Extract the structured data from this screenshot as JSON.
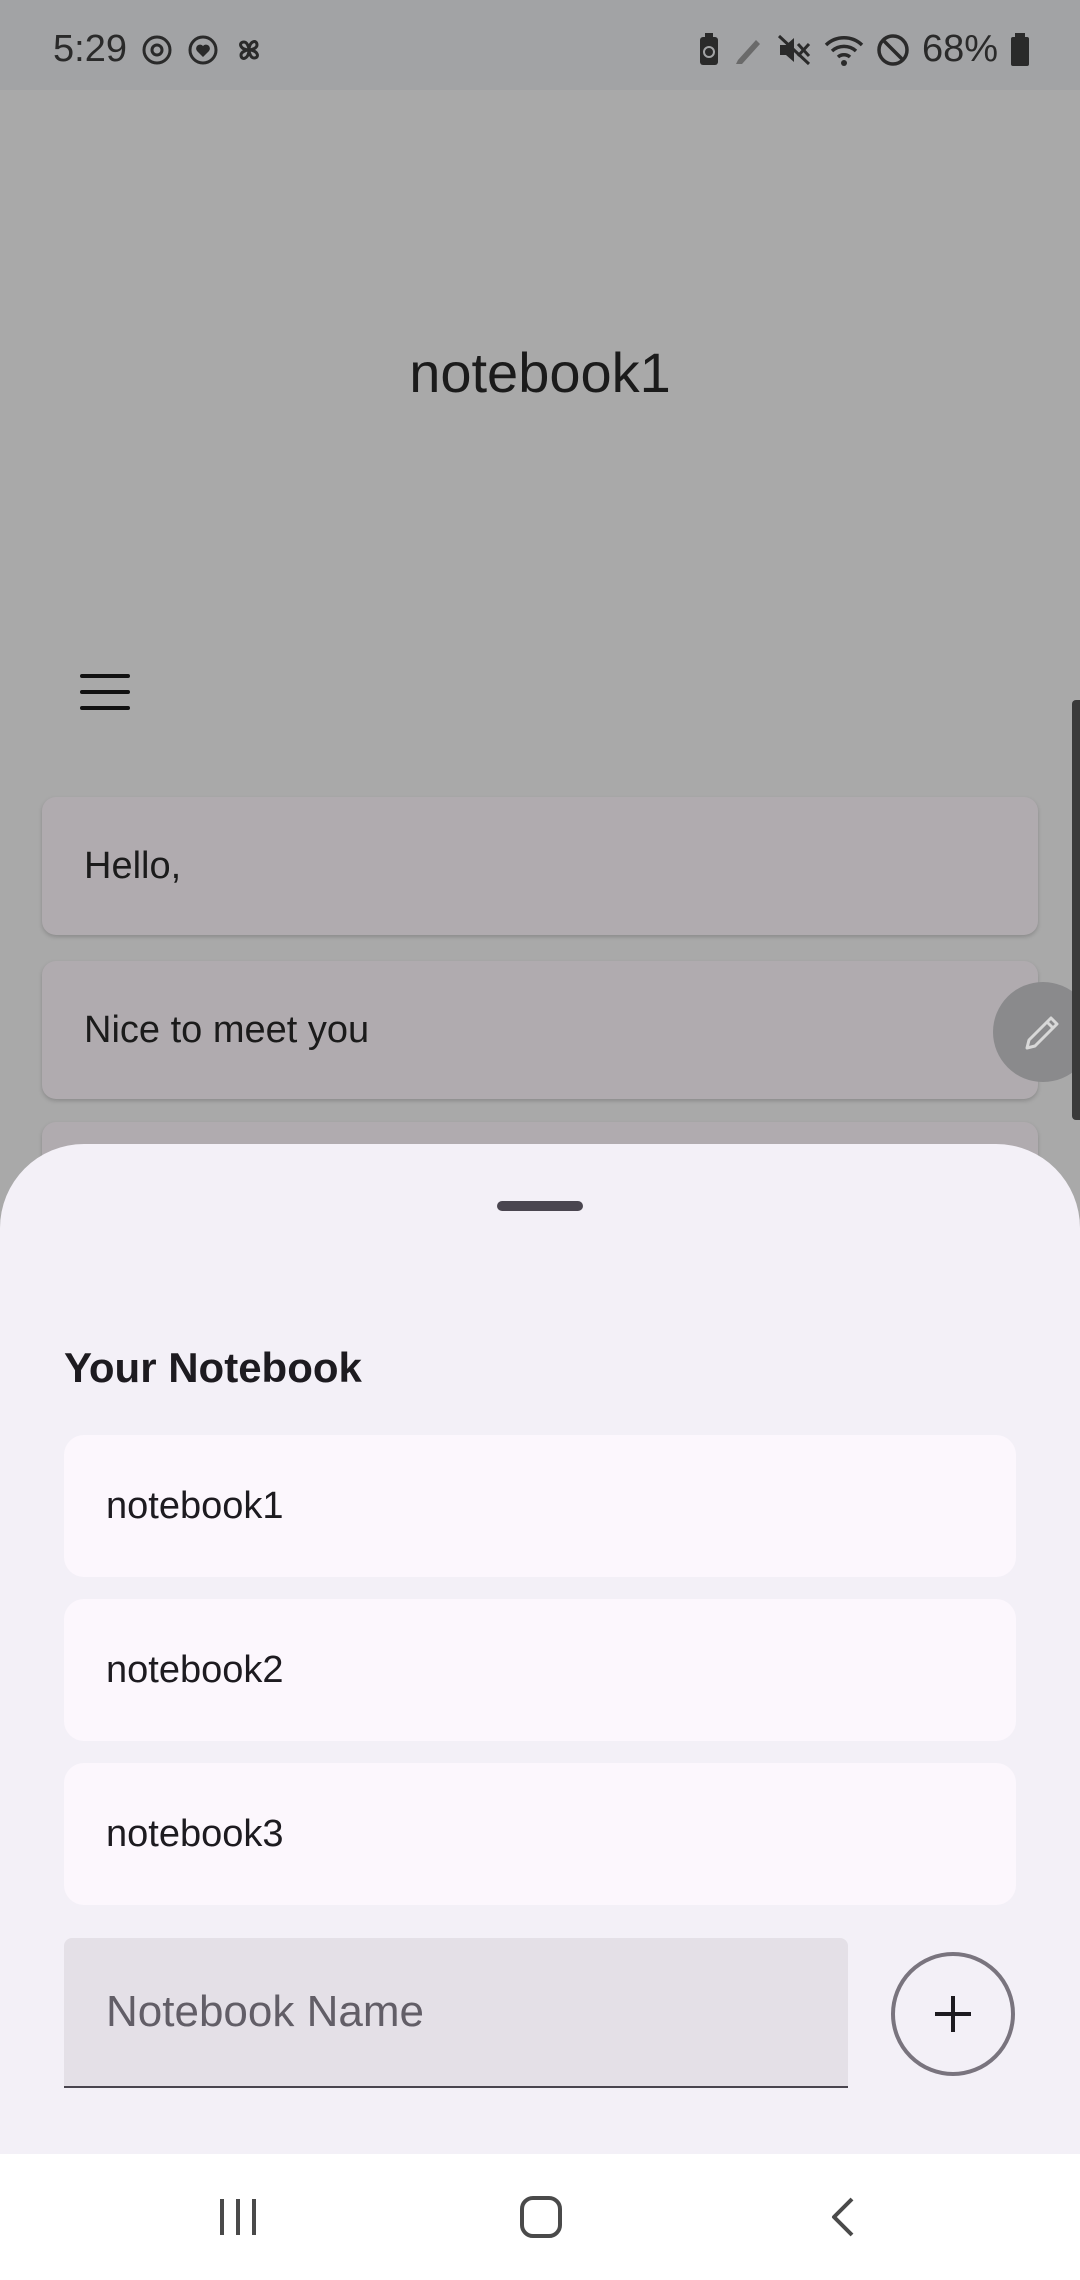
{
  "status_bar": {
    "time": "5:29",
    "left_icons": [
      "vpn-icon",
      "heart-icon",
      "pinwheel-icon"
    ],
    "right_icons": [
      "battery-saver-icon",
      "pen-icon",
      "mute-icon",
      "wifi-icon",
      "do-not-disturb-icon",
      "battery-icon"
    ],
    "battery_percent": "68%"
  },
  "app": {
    "title": "notebook1",
    "menu_icon": "menu-icon",
    "notes": [
      {
        "text": "Hello,"
      },
      {
        "text": "Nice to meet you"
      }
    ],
    "edit_icon": "pencil-icon"
  },
  "sheet": {
    "title": "Your Notebook",
    "notebooks": [
      {
        "name": "notebook1"
      },
      {
        "name": "notebook2"
      },
      {
        "name": "notebook3"
      }
    ],
    "input": {
      "placeholder": "Notebook Name",
      "value": ""
    },
    "add_icon": "plus-icon"
  },
  "nav_bar": {
    "buttons": [
      "recent-apps-icon",
      "home-icon",
      "back-icon"
    ]
  },
  "colors": {
    "scrim": "#a9a9a9",
    "sheet_bg": "#f3f0f7",
    "item_bg": "#fcf7fd",
    "field_bg": "#e4e0e7",
    "note_card_bg": "#b0abaf"
  }
}
